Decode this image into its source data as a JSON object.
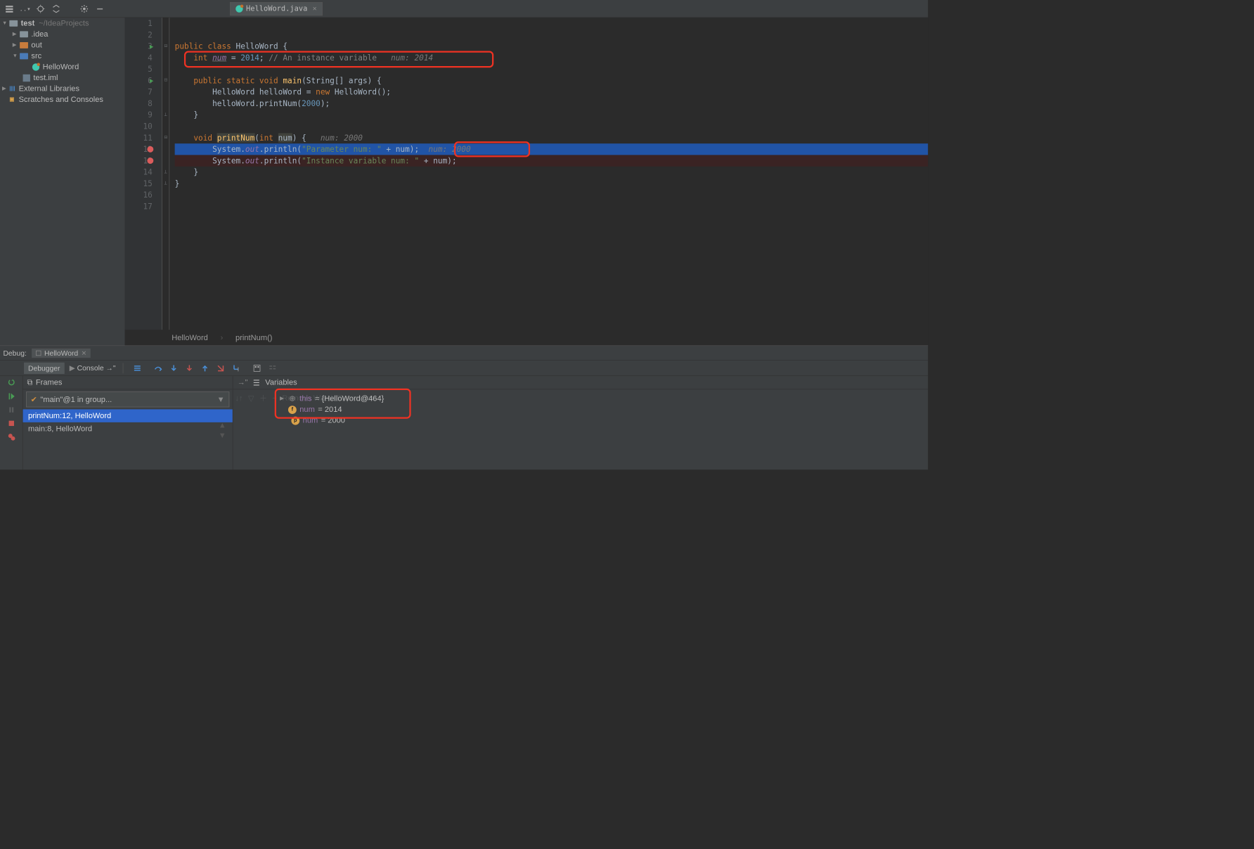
{
  "breadcrumbs": {
    "project": "test",
    "src": "src",
    "file_icon": "java",
    "file": "HelloWord"
  },
  "toolbar": {},
  "tab": {
    "title": "HelloWord.java"
  },
  "project_tree": {
    "root": {
      "name": "test",
      "path": "~/IdeaProjects"
    },
    "idea": ".idea",
    "out": "out",
    "src": "src",
    "file_java": "HelloWord",
    "file_iml": "test.iml",
    "external": "External Libraries",
    "scratches": "Scratches and Consoles"
  },
  "code": {
    "l1": "",
    "l2": "",
    "l3": {
      "kw1": "public",
      "kw2": "class",
      "name": "HelloWord",
      "brace": "{"
    },
    "l4": {
      "kw": "int",
      "var": "num",
      "eq": "=",
      "val": "2014",
      "semi": ";",
      "cmt": "// An instance variable",
      "hint": "num: 2014"
    },
    "l5": "",
    "l6": {
      "kw1": "public",
      "kw2": "static",
      "kw3": "void",
      "m": "main",
      "args": "(String[] args) {"
    },
    "l7": {
      "t": "HelloWord ",
      "v": "helloWord",
      "eq": " = ",
      "kw": "new",
      "call": " HelloWord();"
    },
    "l8": {
      "v": "helloWord",
      "call": ".printNum(",
      "arg": "2000",
      "end": ");"
    },
    "l9": "    }",
    "l10": "",
    "l11": {
      "kw": "void",
      "m": "printNum",
      "p1": "(",
      "pt": "int",
      "pn": "num",
      "p2": ") {",
      "hint": "num: 2000"
    },
    "l12": {
      "pre": "System.",
      "out": "out",
      "call": ".println(",
      "str": "\"Parameter num: \"",
      "plus": " + ",
      "v": "num",
      "end": ");",
      "hint": "num: 2000"
    },
    "l13": {
      "pre": "System.",
      "out": "out",
      "call": ".println(",
      "str": "\"Instance variable num: \"",
      "plus": " + ",
      "v": "num",
      "end": ");"
    },
    "l14": "    }",
    "l15": "}",
    "l16": "",
    "l17": ""
  },
  "nav": {
    "class": "HelloWord",
    "method": "printNum()"
  },
  "debug": {
    "label": "Debug:",
    "config": "HelloWord",
    "tab_debugger": "Debugger",
    "tab_console": "Console",
    "frames_label": "Frames",
    "thread": "\"main\"@1 in group...",
    "frame1": "printNum:12, HelloWord",
    "frame2": "main:8, HelloWord",
    "vars_label": "Variables",
    "watch_hint": "Remove Watch Expression",
    "var_this_name": "this",
    "var_this_val": " = {HelloWord@464}",
    "var_f_name": "num",
    "var_f_val": " = 2014",
    "var_p_name": "num",
    "var_p_val": " = 2000"
  }
}
